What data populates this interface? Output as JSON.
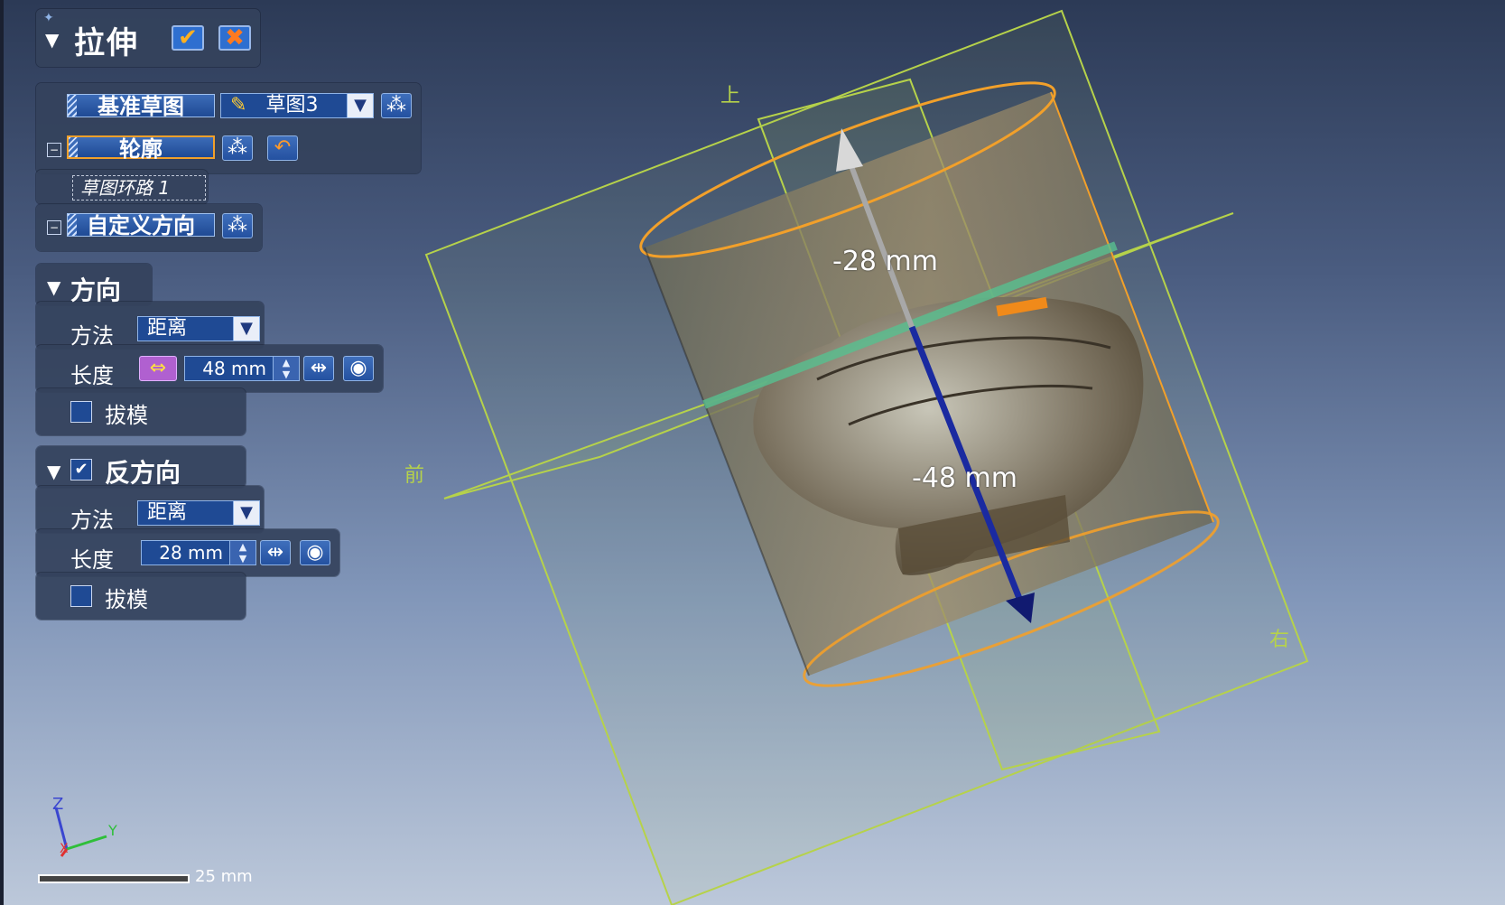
{
  "feature": {
    "title": "拉伸",
    "ok_icon": "ok-check-icon",
    "cancel_icon": "cancel-x-icon"
  },
  "sketch": {
    "base_label": "基准草图",
    "sketch_value": "草图3",
    "profile_label": "轮廓",
    "profile_item": "草图环路 1",
    "custom_direction_label": "自定义方向"
  },
  "direction": {
    "header": "方向",
    "method_label": "方法",
    "method_value": "距离",
    "length_label": "长度",
    "length_value": "48 mm",
    "draft_label": "拔模",
    "draft_checked": false
  },
  "reverse": {
    "header": "反方向",
    "checked": true,
    "method_label": "方法",
    "method_value": "距离",
    "length_label": "长度",
    "length_value": "28 mm",
    "draft_label": "拔模",
    "draft_checked": false
  },
  "viewport": {
    "dim_top": "-28 mm",
    "dim_bottom": "-48 mm",
    "plane_top": "上",
    "plane_front": "前",
    "plane_right": "右",
    "axis_z": "Z",
    "axis_y": "Y",
    "axis_x": "X",
    "scale_label": "25 mm"
  },
  "colors": {
    "accent_blue": "#1f4a94",
    "plane_green": "#b6d24a",
    "edge_orange": "#f2a02a"
  }
}
